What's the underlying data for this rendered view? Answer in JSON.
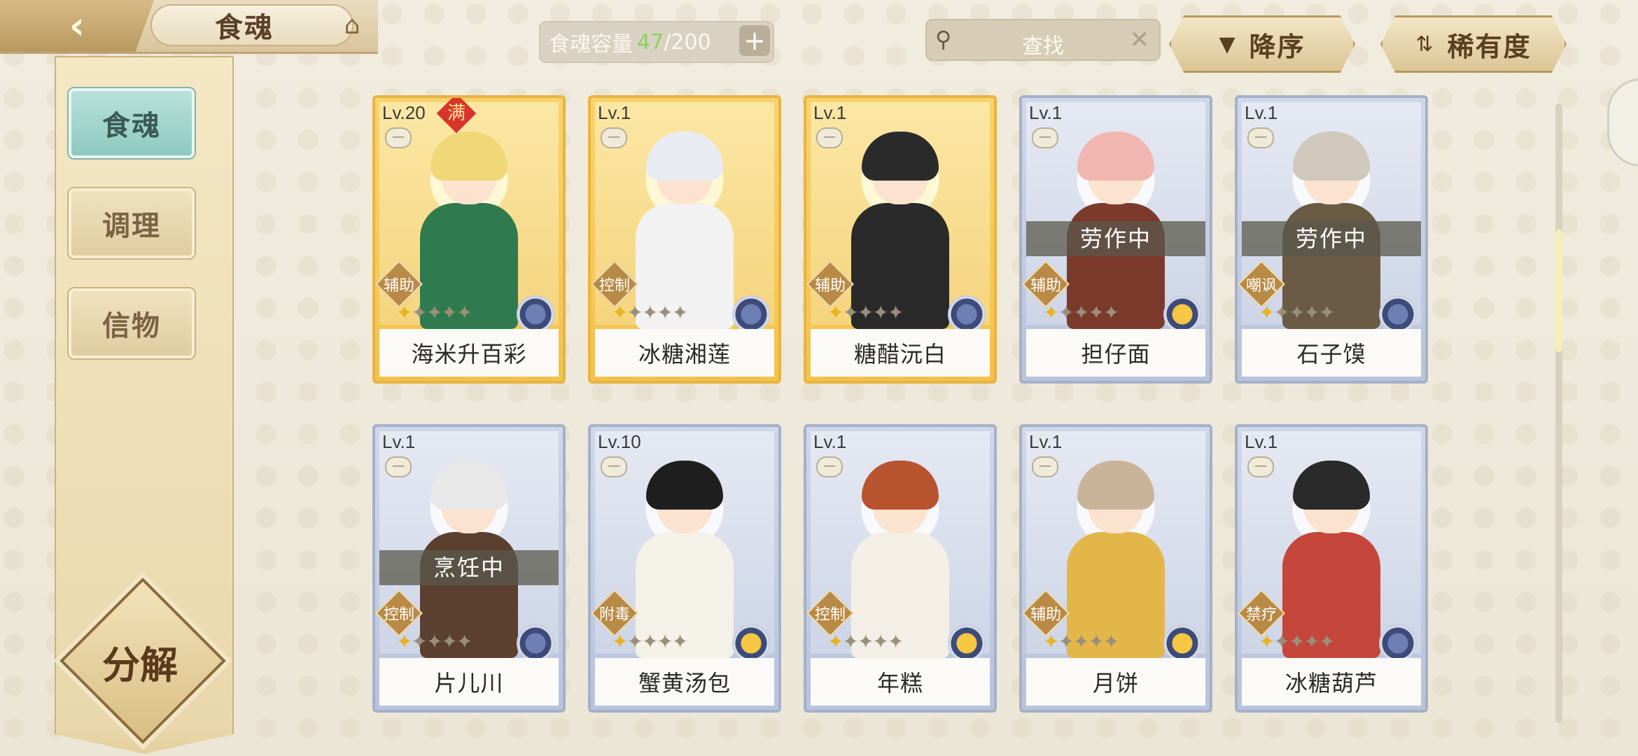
{
  "header": {
    "title": "食魂",
    "capacity_label": "食魂容量",
    "capacity_current": "47",
    "capacity_max": "/200",
    "search_placeholder": "查找",
    "sort_order_label": "降序",
    "sort_rarity_label": "稀有度"
  },
  "sidebar": {
    "tabs": [
      {
        "label": "食魂",
        "active": true
      },
      {
        "label": "调理",
        "active": false
      },
      {
        "label": "信物",
        "active": false
      }
    ],
    "decompose_label": "分解"
  },
  "colors": {
    "gold_frame": "#e7b443",
    "silver_frame": "#a6b0c8",
    "capacity_current": "#8fcf60",
    "active_tab": "#8dc9c0"
  },
  "cards": [
    {
      "name": "海米升百彩",
      "level": "Lv.20",
      "max_badge": "满",
      "role": "辅助",
      "rarity": "gold",
      "stars_on": 1,
      "stars_total": 5,
      "status": "",
      "element": "blue-flower-icon",
      "hair": "#f0d777",
      "body": "#2f7a4f"
    },
    {
      "name": "冰糖湘莲",
      "level": "Lv.1",
      "max_badge": "",
      "role": "控制",
      "rarity": "gold",
      "stars_on": 1,
      "stars_total": 5,
      "status": "",
      "element": "blue-flower-icon",
      "hair": "#e8ecf2",
      "body": "#f2f2f2"
    },
    {
      "name": "糖醋沅白",
      "level": "Lv.1",
      "max_badge": "",
      "role": "辅助",
      "rarity": "gold",
      "stars_on": 1,
      "stars_total": 5,
      "status": "",
      "element": "blue-flower-icon",
      "hair": "#2b2b2b",
      "body": "#2a2a2a"
    },
    {
      "name": "担仔面",
      "level": "Lv.1",
      "max_badge": "",
      "role": "辅助",
      "rarity": "silver",
      "stars_on": 1,
      "stars_total": 5,
      "status": "劳作中",
      "element": "gold-leaf-icon",
      "hair": "#f2b6b0",
      "body": "#7b3a2c"
    },
    {
      "name": "石子馍",
      "level": "Lv.1",
      "max_badge": "",
      "role": "嘲讽",
      "rarity": "silver",
      "stars_on": 1,
      "stars_total": 5,
      "status": "劳作中",
      "element": "blue-flower-icon",
      "hair": "#cfc8bb",
      "body": "#6b5a44"
    },
    {
      "name": "片儿川",
      "level": "Lv.1",
      "max_badge": "",
      "role": "控制",
      "rarity": "silver",
      "stars_on": 1,
      "stars_total": 5,
      "status": "烹饪中",
      "element": "blue-flower-icon",
      "hair": "#e8e8e8",
      "body": "#5b4030"
    },
    {
      "name": "蟹黄汤包",
      "level": "Lv.10",
      "max_badge": "",
      "role": "附毒",
      "rarity": "silver",
      "stars_on": 1,
      "stars_total": 5,
      "status": "",
      "element": "gold-leaf-icon",
      "hair": "#1f1f1f",
      "body": "#f4f1e8"
    },
    {
      "name": "年糕",
      "level": "Lv.1",
      "max_badge": "",
      "role": "控制",
      "rarity": "silver",
      "stars_on": 1,
      "stars_total": 5,
      "status": "",
      "element": "gold-leaf-icon",
      "hair": "#b8532f",
      "body": "#f3efe6"
    },
    {
      "name": "月饼",
      "level": "Lv.1",
      "max_badge": "",
      "role": "辅助",
      "rarity": "silver",
      "stars_on": 1,
      "stars_total": 5,
      "status": "",
      "element": "gold-leaf-icon",
      "hair": "#c9b49a",
      "body": "#e3b649"
    },
    {
      "name": "冰糖葫芦",
      "level": "Lv.1",
      "max_badge": "",
      "role": "禁疗",
      "rarity": "silver",
      "stars_on": 1,
      "stars_total": 5,
      "status": "",
      "element": "blue-flower-icon",
      "hair": "#2a2a2a",
      "body": "#c5463a"
    }
  ]
}
